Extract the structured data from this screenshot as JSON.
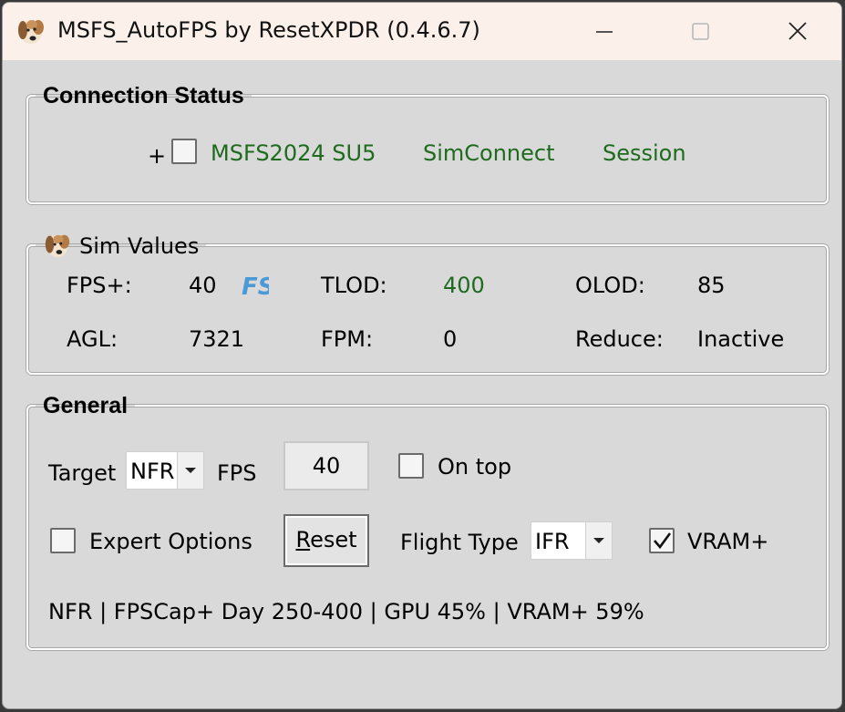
{
  "window": {
    "title": "MSFS_AutoFPS by ResetXPDR (0.4.6.7)",
    "icon": "dog-face-icon"
  },
  "connection": {
    "legend": "Connection Status",
    "plus": "+",
    "checked": false,
    "items": [
      "MSFS2024 SU5",
      "SimConnect",
      "Session"
    ],
    "item_color": "#1e6b1e"
  },
  "sim": {
    "legend": "Sim Values",
    "fps_label": "FPS+:",
    "fps_value": "40",
    "fs_badge": "FS",
    "tlod_label": "TLOD:",
    "tlod_value": "400",
    "olod_label": "OLOD:",
    "olod_value": "85",
    "agl_label": "AGL:",
    "agl_value": "7321",
    "fpm_label": "FPM:",
    "fpm_value": "0",
    "reduce_label": "Reduce:",
    "reduce_value": "Inactive"
  },
  "general": {
    "legend": "General",
    "target_label": "Target",
    "target_mode": "NFR",
    "fps_label": "FPS",
    "fps_input": "40",
    "ontop_label": "On top",
    "ontop_checked": false,
    "expert_label": "Expert Options",
    "expert_checked": false,
    "reset_prefix": "R",
    "reset_rest": "eset",
    "flight_type_label": "Flight Type",
    "flight_type_value": "IFR",
    "vram_label": "VRAM+",
    "vram_checked": true,
    "status_line": "NFR | FPSCap+ Day 250-400 | GPU 45% | VRAM+ 59%"
  }
}
